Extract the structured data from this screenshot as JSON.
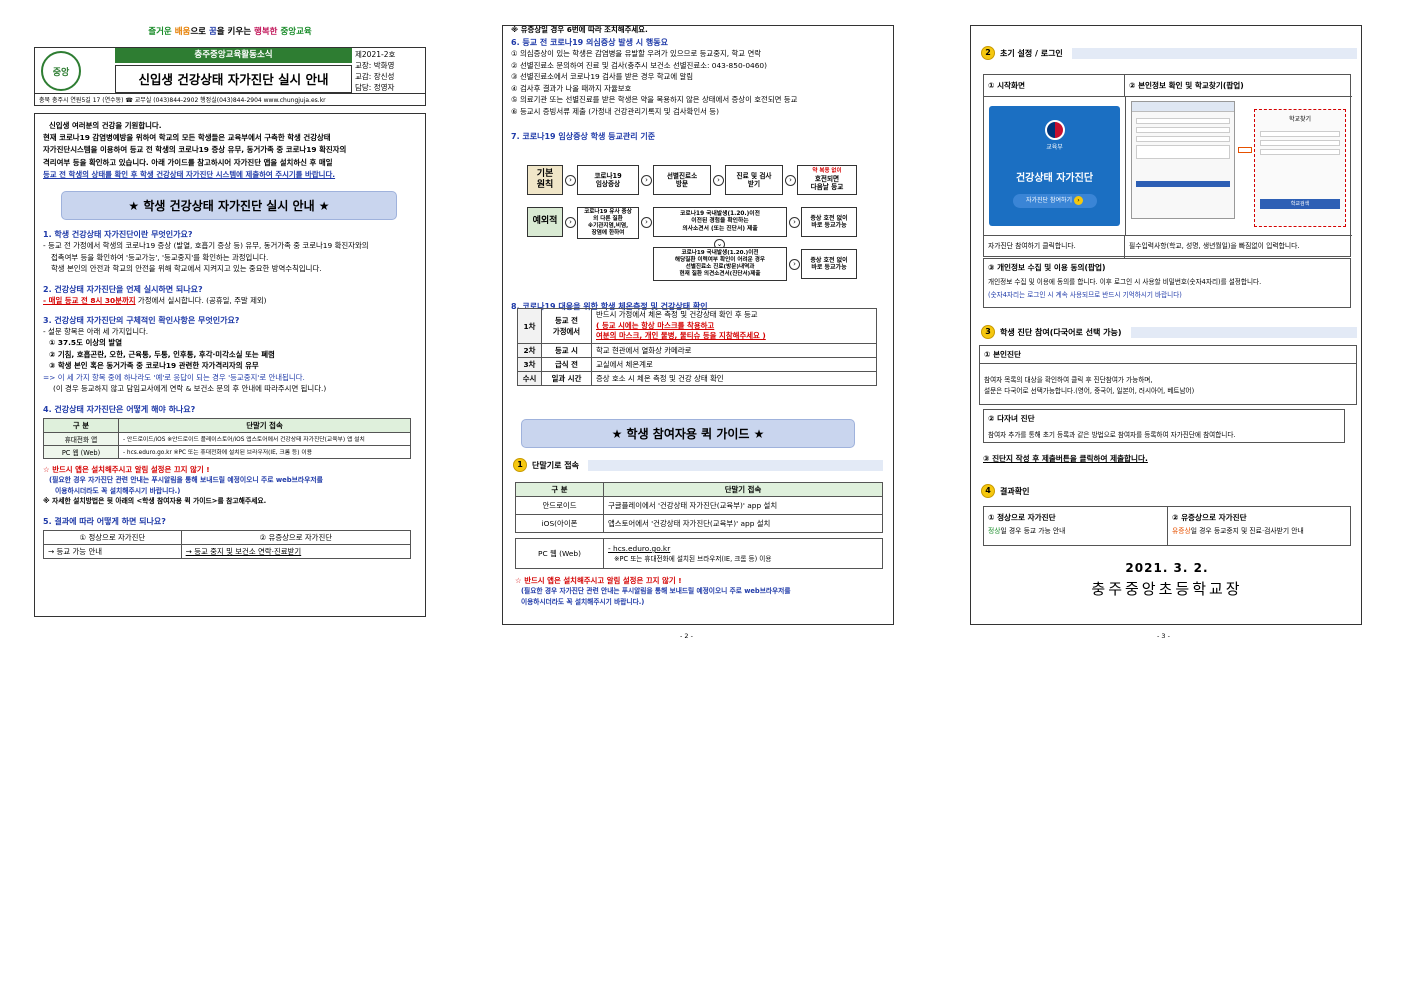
{
  "page1": {
    "slogan": [
      "즐거운",
      "배움",
      "으로",
      "꿈",
      "을 키우는",
      "행복한",
      "중앙교육"
    ],
    "logo_text": "중앙",
    "org": "충주중앙교육활동소식",
    "title": "신입생 건강상태 자가진단 실시 안내",
    "meta": [
      "제2021-2호",
      "교장: 박화영",
      "교감: 장신성",
      "담당: 정영자"
    ],
    "contact": "충북 충주시 연원5길 17 (연수동)   ☎ 교무실 (043)844-2902 행정실(043)844-2904    www.chungjuja.es.kr",
    "intro": [
      "신입생 여러분의 건강을 기원합니다.",
      "현재 코로나19 감염병예방을 위하여 학교의 모든 학생들은 교육부에서 구축한 학생 건강상태",
      "자가진단시스템을 이용하여 등교 전 학생의 코로나19 증상 유무, 동거가족 중 코로나19 확진자의",
      "격리여부 등을 확인하고 있습니다. 아래 가이드를 참고하시어 자가진단 앱을 설치하신 후 매일",
      "등교 전 학생의 상태를 확인 후 학생 건강상태 자가진단 시스템에 제출하여 주시기를 바랍니다."
    ],
    "banner": "★ 학생 건강상태 자가진단 실시 안내 ★",
    "q1": "1. 학생 건강상태 자가진단이란 무엇인가요?",
    "a1": [
      "- 등교 전 가정에서 학생의 코로나19 증상 (발열, 호흡기 증상 등) 유무, 동거가족 중 코로나19 확진자와의",
      "접촉여부 등을 확인하여 '등교가능', '등교중지'를 확인하는 과정입니다.",
      "학생 본인의 안전과 학교의 안전을 위해 학교에서 지켜지고 있는 중요한 방역수칙입니다."
    ],
    "q2": "2. 건강상태 자가진단을 언제 실시하면 되나요?",
    "a2_red": "- 매일 등교 전 8시 30분까지",
    "a2_rest": " 가정에서 실시합니다. (공휴일, 주말 제외)",
    "q3": "3. 건강상태 자가진단의 구체적인 확인사항은 무엇인가요?",
    "a3": [
      "- 설문 항목은 아래 세 가지입니다.",
      "① 37.5도 이상의 발열",
      "② 기침, 호흡곤란, 오한, 근육통, 두통, 인후통, 후각·미각소실 또는 폐렴",
      "③ 학생 본인 혹은 동거가족 중 코로나19 관련한 자가격리자의 유무"
    ],
    "a3_note1": "=> 이 세 가지 항목 중에 하나라도 '예'로 응답이 되는 경우 '등교중지'로 안내됩니다.",
    "a3_note2": "(이 경우 등교하지 않고 담임교사에게 연락 & 보건소 문의 후 안내에 따라주시면 됩니다.)",
    "q4": "4. 건강상태 자가진단은 어떻게 해야 하나요?",
    "t4_head": [
      "구 분",
      "단말기 접속"
    ],
    "t4_rows": [
      [
        "휴대전화 앱",
        "- 안드로이드/iOS ※안드로이드 플레이스토어/iOS 앱스토어에서 건강상태 자가진단(교육부) 앱 설치"
      ],
      [
        "PC 웹 (Web)",
        "- hcs.eduro.go.kr ※PC 또는 휴대전화에 설치된 브라우저(IE, 크롬 등) 이용"
      ]
    ],
    "warn1": "☆ 반드시 앱은 설치해주시고 알림 설정은 끄지 않기 !",
    "warn2": "(필요한 경우 자가진단 관련 안내는 푸시알림을 통해 보내드릴 예정이오니 주로 web브라우저를",
    "warn3": "이용하시더라도 꼭 설치해주시기 바랍니다.)",
    "warn4": "※ 자세한 설치방법은 뒷 아래의 <학생 참여자용 퀵 가이드>를 참고해주세요.",
    "q5": "5. 결과에 따라 어떻게 하면 되나요?",
    "t5_head": [
      "① 정상으로 자가진단",
      "② 유증상으로 자가진단"
    ],
    "t5_row": [
      "→ 등교 가능 안내",
      "→ 등교 중지 및 보건소 연락·진료받기"
    ],
    "t5_green": "정상",
    "t5_orange": "유증상"
  },
  "page2": {
    "top_cut": "※ 유증상일 경우 6번에 따라 조치해주세요.",
    "h6": "6. 등교 전 코로나19 의심증상 발생 시 행동요",
    "s6": [
      "① 의심증상이 있는 학생은 감염병을 유발할 우려가 있으므로 등교중지, 학교 연락",
      "② 선별진료소 문의하여 진료 및 검사(충주시 보건소 선별진료소: 043-850-0460)",
      "③ 선별진료소에서 코로나19 검사를 받은 경우 학교에 알림",
      "④ 검사후 결과가 나올 때까지 자율보호",
      "⑤ 의료기관 또는 선별진료를 받은 학생은 약을 복용하지 않은 상태에서 증상이 호전되면 등교",
      "⑥ 등교시 증빙서류 제출 (가정내 건강관리기록지 및 검사확인서 등)"
    ],
    "h7": "7. 코로나19 임상증상 학생 등교관리 기준",
    "flow_basic_label": "기본\n원칙",
    "flow_basic": [
      "코로나19\n임상증상",
      "선별진료소\n방문",
      "진료 및 검사\n받기",
      "호전되면\n다음날 등교"
    ],
    "flow_basic_note": "약 복용 없이",
    "flow_exc_label": "예외적",
    "flow_exc": [
      "코로나19 유사 증상\n외 다른 질환\n※기관지염,비염,\n장염에 한하여",
      "코로나19 국내발생(1.20.)이전\n이전된 경험을 확인하는\n의사소견서 (또는 진단서) 제출",
      "증상 호전 없이\n바로 등교가능",
      "코로나19 국내발생(1.20.)이전\n해당질환 이력여부 확인이 어려운 경우\n선별진료소 진료(방문)내역과\n현재 질환 의견소견서(진단서)제출",
      "증상 호전 없이\n바로 등교가능"
    ],
    "h8": "8. 코로나19 대응을 위한 학생 체온측정 및 건강상태 확인",
    "t8": [
      [
        "1차",
        "등교 전\n가정에서",
        "반드시 가정에서 체온 측정 및 건강상태 확인 후 등교"
      ],
      [
        "2차",
        "등교 시",
        "학교 현관에서 열화상 카메라로"
      ],
      [
        "3차",
        "급식 전",
        "교실에서 체온계로"
      ],
      [
        "수시",
        "일과 시간",
        "증상 호소 시 체온 측정 및 건강 상태 확인"
      ]
    ],
    "t8_red1": "( 등교 시에는 항상 마스크를 착용하고",
    "t8_red2": "여분의 마스크, 개인 물병, 물티슈 등을 지참해주세요 )",
    "banner": "★ 학생 참여자용 퀵 가이드 ★",
    "step1": "단말기로 접속",
    "step1_num": "1",
    "t_dev_head": [
      "구 분",
      "단말기 접속"
    ],
    "t_dev_rows": [
      [
        "안드로이드",
        "구글플레이에서 '건강상태 자가진단(교육부)' app 설치"
      ],
      [
        "iOS(아이폰",
        "앱스토어에서 '건강상태 자가진단(교육부)' app 설치"
      ]
    ],
    "pc_label": "PC 웹 (Web)",
    "pc_lines": [
      "- hcs.eduro.go.kr",
      "※PC 또는 휴대전화에 설치된 브라우저(IE, 크롬 등) 이용"
    ],
    "warn1": "☆ 반드시 앱은 설치해주시고 알림 설정은 끄지 않기 !",
    "warn2": "(필요한 경우 자가진단 관련 안내는 푸시알림을 통해 보내드릴 예정이오니 주로 web브라우저를",
    "warn3": "이용하시더라도 꼭 설치해주시기 바랍니다.)",
    "page_no": "- 2 -"
  },
  "page3": {
    "s2_num": "2",
    "s2": "초기 설정 / 로그인",
    "c1_head": "① 시작화면",
    "c2_head": "② 본인정보 확인 및 학교찾기(팝업)",
    "phone_ministry": "교육부",
    "phone_title": "건강상태 자가진단",
    "phone_btn": "자가진단 참여하기",
    "popup_title": "학교찾기",
    "popup_btn": "학교검색",
    "c1_caption": "자가진단 참여하기 클릭합니다.",
    "c2_caption": "필수입력사항(학교, 성명, 생년월일)을 빠짐없이 입력합니다.",
    "c3_head": "③ 개인정보 수집 및 이용 동의(팝업)",
    "c3_text": "개인정보 수집 및 이용에 동의를 합니다. 이후 로그인 시 사용할 비밀번호(숫자4자리)를 설정합니다.",
    "c3_note": "(숫자4자리는 로그인 시 계속 사용되므로 반드시 기억하시기 바랍니다)",
    "s3_num": "3",
    "s3": "학생 진단 참여(다국어로 선택 가능)",
    "b1_head": "① 본인진단",
    "b1_text": [
      "참여자 목록의 대상을 확인하여 클릭 후 진단참여가 가능하며,",
      "설문은 다국어로 선택가능합니다.(영어, 중국어, 일본어, 러시아어, 베트남어)"
    ],
    "b2_head": "② 다자녀 진단",
    "b2_text": "참여자 추가를 통해 초기 등록과 같은 방법으로 참여자를 등록하여 자가진단에 참여합니다.",
    "b3": "③ 진단지 작성 후 제출버튼을 클릭하여 제출합니다.",
    "s4_num": "4",
    "s4": "결과확인",
    "r1_head": "① 정상으로 자가진단",
    "r1_text_green": "정상",
    "r1_text": "일 경우 등교 가능 안내",
    "r2_head": "② 유증상으로 자가진단",
    "r2_text_orange": "유증상",
    "r2_text": "일 경우 등교중지 및 진료·검사받기 안내",
    "date": "2021. 3. 2.",
    "school": "충주중앙초등학교장",
    "page_no": "- 3 -"
  },
  "colors": {
    "blue": "#1f3aa8",
    "red": "#d40000",
    "green": "#1a8c2a",
    "banner": "#c9d5ee",
    "header_bg": "#2e7d32",
    "phone_bg": "#1b6fc2"
  }
}
